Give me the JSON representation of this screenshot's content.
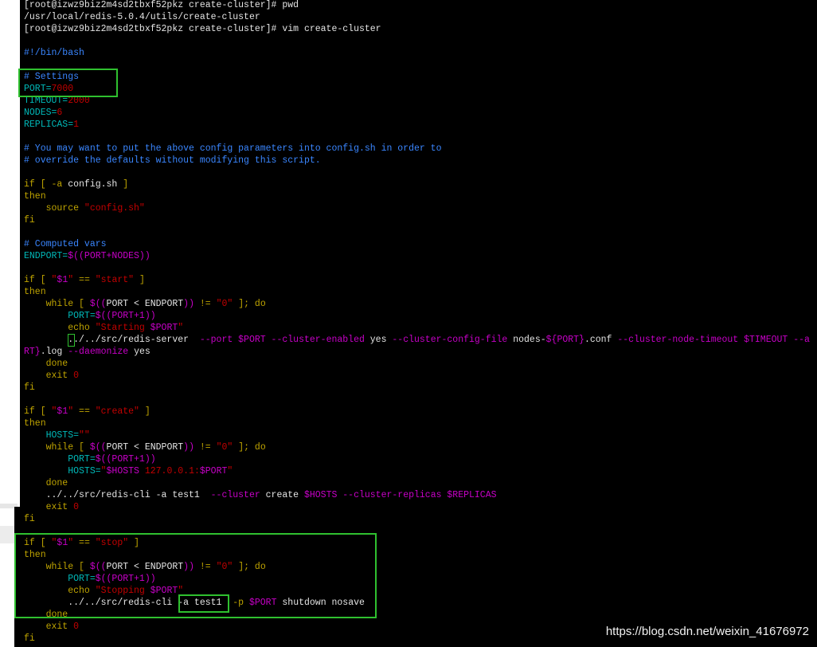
{
  "terminal": {
    "colors": {
      "plain": "#e4e4e4",
      "keyword": "#bfa400",
      "string": "#c40000",
      "variable": "#c800c8",
      "assign": "#00b8b8",
      "comment": "#3a86ff",
      "highlight_box": "#2fc02f"
    },
    "lines": [
      [
        [
          "w",
          "[root@izwz9biz2m4sd2tbxf52pkz create-cluster]# pwd"
        ]
      ],
      [
        [
          "w",
          "/usr/local/redis-5.0.4/utils/create-cluster"
        ]
      ],
      [
        [
          "w",
          "[root@izwz9biz2m4sd2tbxf52pkz create-cluster]# vim create-cluster"
        ]
      ],
      [],
      [
        [
          "b",
          "#!/bin/bash"
        ]
      ],
      [],
      [
        [
          "b",
          "# Settings"
        ]
      ],
      [
        [
          "c",
          "PORT="
        ],
        [
          "r",
          "7000"
        ]
      ],
      [
        [
          "c",
          "TIMEOUT="
        ],
        [
          "r",
          "2000"
        ]
      ],
      [
        [
          "c",
          "NODES="
        ],
        [
          "r",
          "6"
        ]
      ],
      [
        [
          "c",
          "REPLICAS="
        ],
        [
          "r",
          "1"
        ]
      ],
      [],
      [
        [
          "b",
          "# You may want to put the above config parameters into config.sh in order to"
        ]
      ],
      [
        [
          "b",
          "# override the defaults without modifying this script."
        ]
      ],
      [],
      [
        [
          "k",
          "if [ -a "
        ],
        [
          "w",
          "config.sh"
        ],
        [
          "k",
          " ]"
        ]
      ],
      [
        [
          "k",
          "then"
        ]
      ],
      [
        [
          "k",
          "    source "
        ],
        [
          "r",
          "\"config.sh\""
        ]
      ],
      [
        [
          "k",
          "fi"
        ]
      ],
      [],
      [
        [
          "b",
          "# Computed vars"
        ]
      ],
      [
        [
          "c",
          "ENDPORT="
        ],
        [
          "m",
          "$((PORT+NODES))"
        ]
      ],
      [],
      [
        [
          "k",
          "if [ "
        ],
        [
          "r",
          "\""
        ],
        [
          "m",
          "$1"
        ],
        [
          "r",
          "\""
        ],
        [
          "k",
          " == "
        ],
        [
          "r",
          "\"start\""
        ],
        [
          "k",
          " ]"
        ]
      ],
      [
        [
          "k",
          "then"
        ]
      ],
      [
        [
          "k",
          "    while [ "
        ],
        [
          "m",
          "$(("
        ],
        [
          "w",
          "PORT < ENDPORT"
        ],
        [
          "m",
          "))"
        ],
        [
          "k",
          " != "
        ],
        [
          "r",
          "\"0\""
        ],
        [
          "k",
          " ]; do"
        ]
      ],
      [
        [
          "c",
          "        PORT="
        ],
        [
          "m",
          "$((PORT+1))"
        ]
      ],
      [
        [
          "k",
          "        echo "
        ],
        [
          "r",
          "\"Starting "
        ],
        [
          "m",
          "$PORT"
        ],
        [
          "r",
          "\""
        ]
      ],
      [
        [
          "w",
          "        ../../src/redis-server  "
        ],
        [
          "m",
          "--port $PORT --cluster-enabled "
        ],
        [
          "w",
          "yes "
        ],
        [
          "m",
          "--cluster-config-file "
        ],
        [
          "w",
          "nodes-"
        ],
        [
          "m",
          "${PORT}"
        ],
        [
          "w",
          ".conf "
        ],
        [
          "m",
          "--cluster-node-timeout $TIMEOUT --a"
        ]
      ],
      [
        [
          "m",
          "RT}"
        ],
        [
          "w",
          ".log "
        ],
        [
          "m",
          "--daemonize "
        ],
        [
          "w",
          "yes"
        ]
      ],
      [
        [
          "k",
          "    done"
        ]
      ],
      [
        [
          "k",
          "    exit "
        ],
        [
          "r",
          "0"
        ]
      ],
      [
        [
          "k",
          "fi"
        ]
      ],
      [],
      [
        [
          "k",
          "if [ "
        ],
        [
          "r",
          "\""
        ],
        [
          "m",
          "$1"
        ],
        [
          "r",
          "\""
        ],
        [
          "k",
          " == "
        ],
        [
          "r",
          "\"create\""
        ],
        [
          "k",
          " ]"
        ]
      ],
      [
        [
          "k",
          "then"
        ]
      ],
      [
        [
          "c",
          "    HOSTS="
        ],
        [
          "r",
          "\"\""
        ]
      ],
      [
        [
          "k",
          "    while [ "
        ],
        [
          "m",
          "$(("
        ],
        [
          "w",
          "PORT < ENDPORT"
        ],
        [
          "m",
          "))"
        ],
        [
          "k",
          " != "
        ],
        [
          "r",
          "\"0\""
        ],
        [
          "k",
          " ]; do"
        ]
      ],
      [
        [
          "c",
          "        PORT="
        ],
        [
          "m",
          "$((PORT+1))"
        ]
      ],
      [
        [
          "c",
          "        HOSTS="
        ],
        [
          "r",
          "\""
        ],
        [
          "m",
          "$HOSTS"
        ],
        [
          "r",
          " 127.0.0.1:"
        ],
        [
          "m",
          "$PORT"
        ],
        [
          "r",
          "\""
        ]
      ],
      [
        [
          "k",
          "    done"
        ]
      ],
      [
        [
          "w",
          "    ../../src/redis-cli -a test1  "
        ],
        [
          "m",
          "--cluster "
        ],
        [
          "w",
          "create "
        ],
        [
          "m",
          "$HOSTS --cluster-replicas $REPLICAS"
        ]
      ],
      [
        [
          "k",
          "    exit "
        ],
        [
          "r",
          "0"
        ]
      ],
      [
        [
          "k",
          "fi"
        ]
      ],
      [],
      [
        [
          "k",
          "if [ "
        ],
        [
          "r",
          "\""
        ],
        [
          "m",
          "$1"
        ],
        [
          "r",
          "\""
        ],
        [
          "k",
          " == "
        ],
        [
          "r",
          "\"stop\""
        ],
        [
          "k",
          " ]"
        ]
      ],
      [
        [
          "k",
          "then"
        ]
      ],
      [
        [
          "k",
          "    while [ "
        ],
        [
          "m",
          "$(("
        ],
        [
          "w",
          "PORT < ENDPORT"
        ],
        [
          "m",
          "))"
        ],
        [
          "k",
          " != "
        ],
        [
          "r",
          "\"0\""
        ],
        [
          "k",
          " ]; do"
        ]
      ],
      [
        [
          "c",
          "        PORT="
        ],
        [
          "m",
          "$((PORT+1))"
        ]
      ],
      [
        [
          "k",
          "        echo "
        ],
        [
          "r",
          "\"Stopping "
        ],
        [
          "m",
          "$PORT"
        ],
        [
          "r",
          "\""
        ]
      ],
      [
        [
          "w",
          "        ../../src/redis-cli -a test1  "
        ],
        [
          "k",
          "-p "
        ],
        [
          "m",
          "$PORT "
        ],
        [
          "w",
          "shutdown nosave"
        ]
      ],
      [
        [
          "k",
          "    done"
        ]
      ],
      [
        [
          "k",
          "    exit "
        ],
        [
          "r",
          "0"
        ]
      ],
      [
        [
          "k",
          "fi"
        ]
      ]
    ]
  },
  "watermark": "https://blog.csdn.net/weixin_41676972"
}
